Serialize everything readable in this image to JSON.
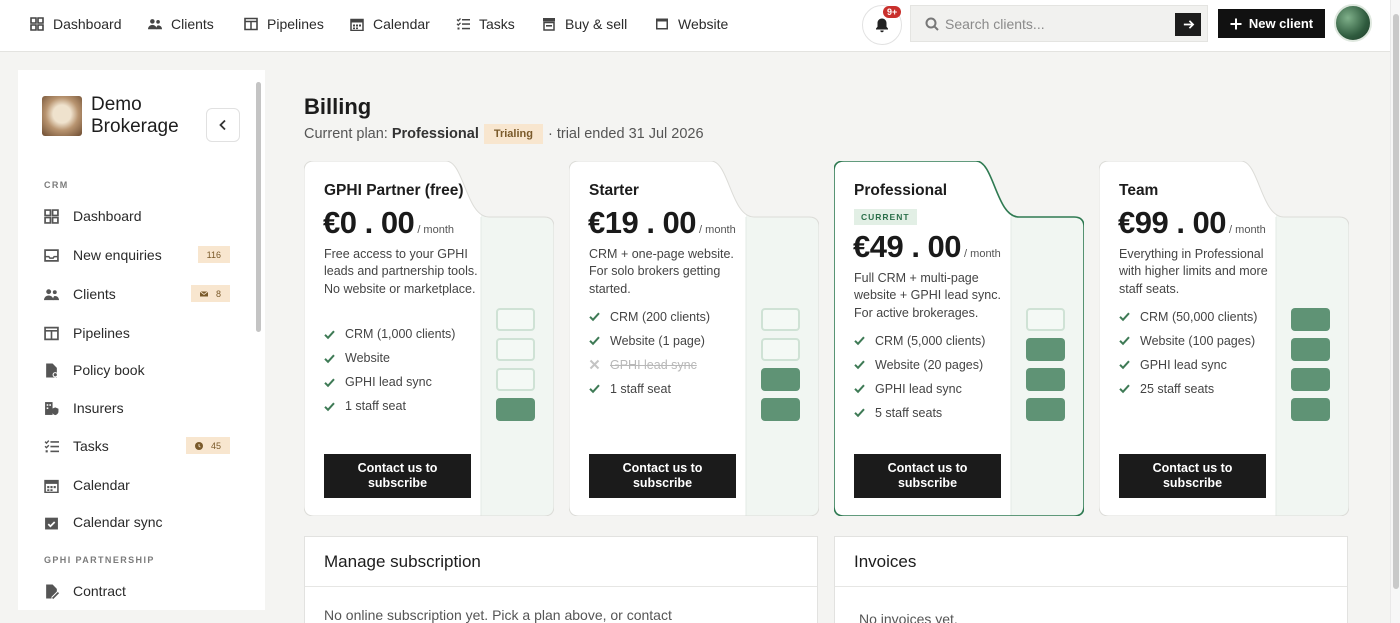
{
  "nav": {
    "items": [
      {
        "label": "Dashboard",
        "icon": "grid-icon"
      },
      {
        "label": "Clients",
        "icon": "users-icon"
      },
      {
        "label": "Pipelines",
        "icon": "columns-icon"
      },
      {
        "label": "Calendar",
        "icon": "calendar-icon"
      },
      {
        "label": "Tasks",
        "icon": "tasks-icon"
      },
      {
        "label": "Buy & sell",
        "icon": "store-icon"
      },
      {
        "label": "Website",
        "icon": "window-icon"
      }
    ],
    "notifications_badge": "9+",
    "search_placeholder": "Search clients...",
    "new_client_label": "New client"
  },
  "sidebar": {
    "brand": "Demo Brokerage",
    "sections": {
      "crm": "CRM",
      "partnership": "GPHI PARTNERSHIP"
    },
    "items": [
      {
        "label": "Dashboard"
      },
      {
        "label": "New enquiries",
        "badge": "116"
      },
      {
        "label": "Clients",
        "badge": "8",
        "badge_icon": "mail-icon"
      },
      {
        "label": "Pipelines"
      },
      {
        "label": "Policy book"
      },
      {
        "label": "Insurers"
      },
      {
        "label": "Tasks",
        "badge": "45",
        "badge_icon": "clock-icon"
      },
      {
        "label": "Calendar"
      },
      {
        "label": "Calendar sync"
      },
      {
        "label": "Contract"
      }
    ]
  },
  "billing": {
    "title": "Billing",
    "current_plan_prefix": "Current plan:",
    "current_plan": "Professional",
    "status_badge": "Trialing",
    "trial_text": "· trial ended 31 Jul 2026"
  },
  "plans": [
    {
      "name": "GPHI Partner (free)",
      "price": "€0.00",
      "per": "/ month",
      "current_tag": "",
      "description": "Free access to your GPHI leads and partnership tools. No website or marketplace.",
      "features": [
        {
          "text": "CRM (1,000 clients)",
          "included": true
        },
        {
          "text": "Website",
          "included": true
        },
        {
          "text": "GPHI lead sync",
          "included": true
        },
        {
          "text": "1 staff seat",
          "included": true
        }
      ],
      "cta": "Contact us to subscribe",
      "tiers_filled": 1
    },
    {
      "name": "Starter",
      "price": "€19.00",
      "per": "/ month",
      "current_tag": "",
      "description": "CRM + one-page website. For solo brokers getting started.",
      "features": [
        {
          "text": "CRM (200 clients)",
          "included": true
        },
        {
          "text": "Website (1 page)",
          "included": true
        },
        {
          "text": "GPHI lead sync",
          "included": false
        },
        {
          "text": "1 staff seat",
          "included": true
        }
      ],
      "cta": "Contact us to subscribe",
      "tiers_filled": 2
    },
    {
      "name": "Professional",
      "price": "€49.00",
      "per": "/ month",
      "current_tag": "CURRENT",
      "description": "Full CRM + multi-page website + GPHI lead sync. For active brokerages.",
      "features": [
        {
          "text": "CRM (5,000 clients)",
          "included": true
        },
        {
          "text": "Website (20 pages)",
          "included": true
        },
        {
          "text": "GPHI lead sync",
          "included": true
        },
        {
          "text": "5 staff seats",
          "included": true
        }
      ],
      "cta": "Contact us to subscribe",
      "tiers_filled": 3
    },
    {
      "name": "Team",
      "price": "€99.00",
      "per": "/ month",
      "current_tag": "",
      "description": "Everything in Professional with higher limits and more staff seats.",
      "features": [
        {
          "text": "CRM (50,000 clients)",
          "included": true
        },
        {
          "text": "Website (100 pages)",
          "included": true
        },
        {
          "text": "GPHI lead sync",
          "included": true
        },
        {
          "text": "25 staff seats",
          "included": true
        }
      ],
      "cta": "Contact us to subscribe",
      "tiers_filled": 4
    }
  ],
  "manage": {
    "title": "Manage subscription",
    "body": "No online subscription yet. Pick a plan above, or contact"
  },
  "invoices": {
    "title": "Invoices",
    "body": "No invoices yet."
  },
  "colors": {
    "accent_green": "#5f9375",
    "current_border": "#2f7a52",
    "badge_bg": "#f8e6cf",
    "primary_button": "#1b1b1b"
  }
}
